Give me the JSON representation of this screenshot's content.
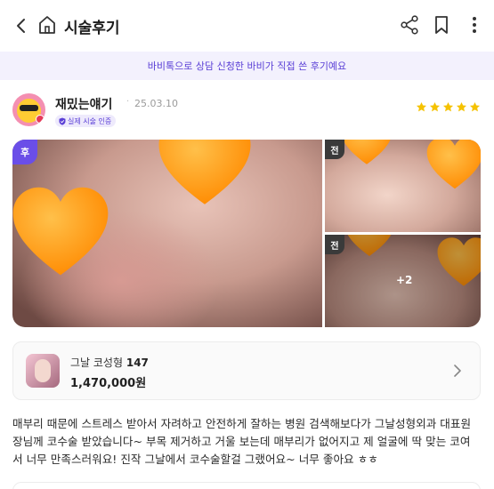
{
  "header": {
    "title": "시술후기"
  },
  "banner": {
    "text": "바비톡으로 상담 신청한 바비가 직접 쓴 후기예요"
  },
  "review_meta": {
    "username": "재밌는얘기",
    "separator": "·",
    "date": "25.03.10",
    "verified_label": "실제 시술 인증",
    "rating": 5
  },
  "gallery": {
    "after_label": "후",
    "before_label_1": "전",
    "before_label_2": "전",
    "more_count": "+2"
  },
  "product": {
    "name": "그날 코성형",
    "count": "147",
    "price": "1,470,000원"
  },
  "review": {
    "text": "매부리 때문에 스트레스 받아서 자려하고 안전하게 잘하는 병원 검색해보다가 그날성형외과 대표원장님께 코수술 받았습니다~ 부목 제거하고 거울 보는데 매부리가 없어지고 제 얼굴에 딱 맞는 코여서 너무 만족스러워요! 진작 그날에서 코수술할걸 그랬어요~ 너무 좋아요 ㅎㅎ"
  },
  "colors": {
    "accent": "#5a3fd6",
    "star": "#f5c200",
    "heart": "#ff9a1a"
  }
}
